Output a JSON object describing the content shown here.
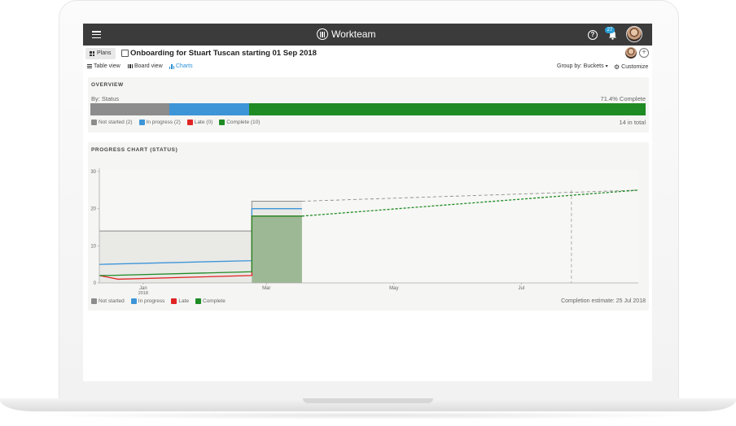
{
  "app": {
    "brand": "Workteam",
    "notifications_count": "27",
    "help_glyph": "?"
  },
  "plan": {
    "plans_label": "Plans",
    "title": "Onboarding for Stuart Tuscan starting 01 Sep 2018"
  },
  "views": {
    "table": "Table view",
    "board": "Board view",
    "charts": "Charts",
    "group_by": "Group by: Buckets",
    "customize": "Customize"
  },
  "overview": {
    "title": "OVERVIEW",
    "by": "By: Status",
    "percent": "71.4% Complete",
    "total": "14 in total",
    "segments": [
      {
        "label": "Not started (2)",
        "count": 2,
        "color": "#8c8c8c"
      },
      {
        "label": "In progress (2)",
        "count": 2,
        "color": "#3d95d8"
      },
      {
        "label": "Late (0)",
        "count": 0,
        "color": "#e02424"
      },
      {
        "label": "Complete (10)",
        "count": 10,
        "color": "#1f8b24"
      }
    ]
  },
  "progress": {
    "title": "PROGRESS CHART (STATUS)",
    "completion": "Completion estimate: 25 Jul 2018",
    "legend": [
      {
        "label": "Not started",
        "color": "#8c8c8c"
      },
      {
        "label": "In progress",
        "color": "#3d95d8"
      },
      {
        "label": "Late",
        "color": "#e02424"
      },
      {
        "label": "Complete",
        "color": "#1f8b24"
      }
    ]
  },
  "chart_data": {
    "type": "area",
    "x_start": "2017-12-11",
    "x_end": "2018-08-26",
    "ylim": [
      0,
      30
    ],
    "yticks": [
      0,
      10,
      20,
      30
    ],
    "xticks": [
      {
        "date": "2018-01-01",
        "label": "Jan",
        "sublabel": "2018"
      },
      {
        "date": "2018-03-01",
        "label": "Mar",
        "sublabel": ""
      },
      {
        "date": "2018-05-01",
        "label": "May",
        "sublabel": ""
      },
      {
        "date": "2018-07-01",
        "label": "Jul",
        "sublabel": ""
      }
    ],
    "series": [
      {
        "name": "Not started",
        "color": "#8c8c8c",
        "points": [
          [
            "2017-12-11",
            14
          ],
          [
            "2018-02-22",
            14
          ],
          [
            "2018-02-22",
            22
          ],
          [
            "2018-03-18",
            22
          ]
        ]
      },
      {
        "name": "In progress",
        "color": "#3d95d8",
        "points": [
          [
            "2017-12-11",
            5
          ],
          [
            "2018-02-22",
            6
          ],
          [
            "2018-02-22",
            20
          ],
          [
            "2018-03-18",
            20
          ]
        ]
      },
      {
        "name": "Late",
        "color": "#e02424",
        "points": [
          [
            "2017-12-11",
            2
          ],
          [
            "2017-12-20",
            1
          ],
          [
            "2018-02-22",
            2
          ],
          [
            "2018-02-22",
            18
          ],
          [
            "2018-03-18",
            18
          ]
        ]
      },
      {
        "name": "Complete",
        "color": "#1f8b24",
        "points": [
          [
            "2017-12-11",
            2
          ],
          [
            "2017-12-15",
            2
          ],
          [
            "2018-02-22",
            3
          ],
          [
            "2018-02-22",
            18
          ],
          [
            "2018-03-18",
            18
          ]
        ]
      }
    ],
    "projections": [
      {
        "name": "Not started",
        "color": "#8c8c8c",
        "points": [
          [
            "2018-03-18",
            22
          ],
          [
            "2018-08-26",
            25
          ]
        ]
      },
      {
        "name": "Complete",
        "color": "#1f8b24",
        "points": [
          [
            "2018-03-18",
            18
          ],
          [
            "2018-08-26",
            25
          ]
        ]
      }
    ],
    "completion_estimate": "2018-07-25",
    "grid": false
  }
}
